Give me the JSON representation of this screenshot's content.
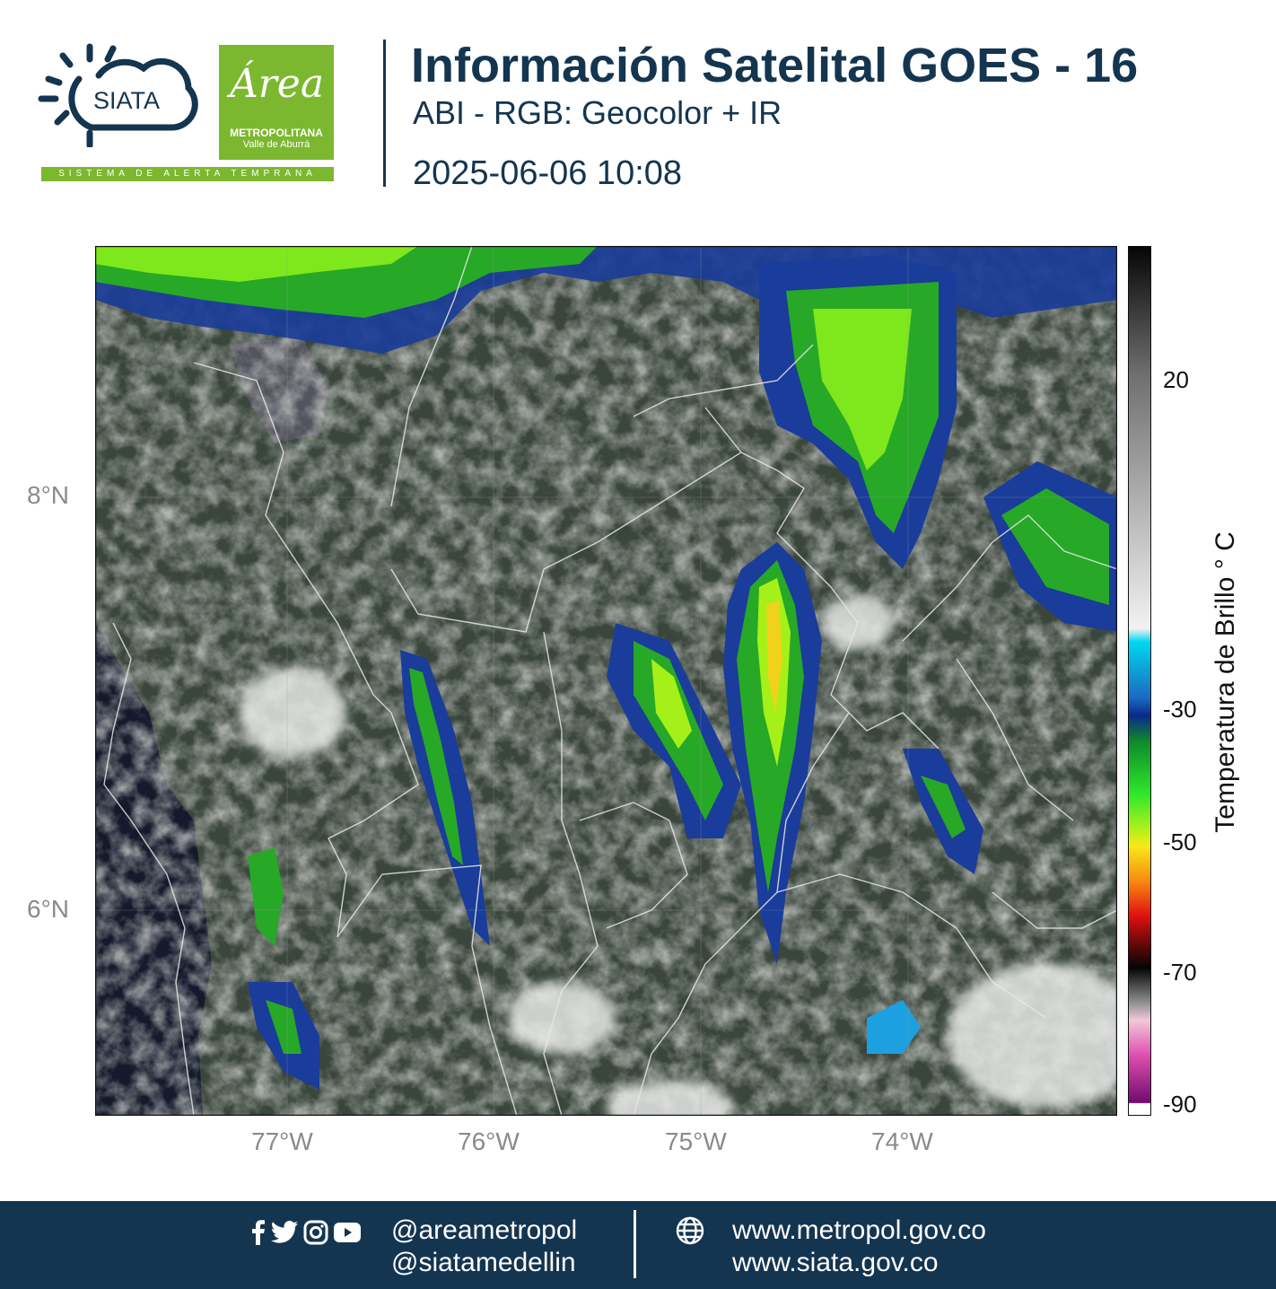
{
  "header": {
    "title": "Información Satelital GOES - 16",
    "subtitle": "ABI - RGB: Geocolor + IR",
    "datetime": "2025-06-06 10:08"
  },
  "logos": {
    "siata_text": "SIATA",
    "area_script": "Área",
    "area_metro": "METROPOLITANA",
    "area_valle": "Valle de Aburrá",
    "alert_strip": "SISTEMA DE ALERTA TEMPRANA"
  },
  "map": {
    "lat_labels": [
      "8°N",
      "6°N"
    ],
    "lon_labels": [
      "77°W",
      "76°W",
      "75°W",
      "74°W"
    ]
  },
  "colorbar": {
    "title": "Temperatura de Brillo ° C",
    "ticks": [
      "20",
      "-30",
      "-50",
      "-70",
      "-90"
    ]
  },
  "footer": {
    "handle_1": "@areametropol",
    "handle_2": "@siatamedellin",
    "site_1": "www.metropol.gov.co",
    "site_2": "www.siata.gov.co"
  },
  "colors": {
    "navy": "#143550",
    "green_brand": "#7cb82f"
  }
}
